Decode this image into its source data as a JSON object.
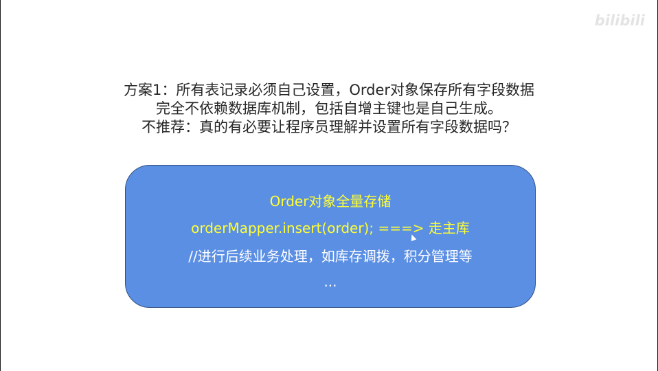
{
  "watermark": {
    "text": "bilibili"
  },
  "heading": {
    "line1": "方案1：所有表记录必须自己设置，Order对象保存所有字段数据",
    "line2": "完全不依赖数据库机制，包括自增主键也是自己生成。",
    "line3": "不推荐：真的有必要让程序员理解并设置所有字段数据吗？"
  },
  "code_box": {
    "title": "Order对象全量存储",
    "insert_line": "orderMapper.insert(order);  ===> 走主库",
    "comment_line": "//进行后续业务处理，如库存调拨，积分管理等",
    "ellipsis": "..."
  },
  "colors": {
    "box_fill": "#5b8fe3",
    "highlight_text": "#ffff33",
    "body_text": "#262626"
  }
}
